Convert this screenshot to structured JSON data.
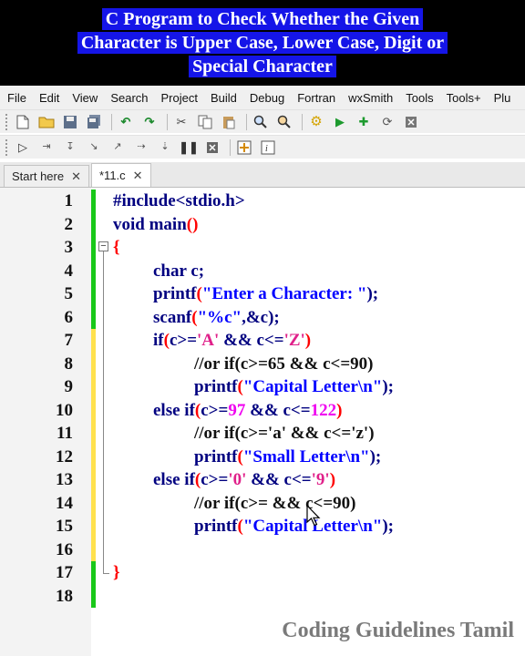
{
  "banner": {
    "lines": [
      "C Program to Check Whether the Given",
      "Character is Upper Case, Lower Case, Digit or",
      "Special Character"
    ]
  },
  "menu": [
    "File",
    "Edit",
    "View",
    "Search",
    "Project",
    "Build",
    "Debug",
    "Fortran",
    "wxSmith",
    "Tools",
    "Tools+",
    "Plu"
  ],
  "tabs": [
    {
      "label": "Start here",
      "active": false
    },
    {
      "label": "*11.c",
      "active": true
    }
  ],
  "editor": {
    "line_numbers": [
      "1",
      "2",
      "3",
      "4",
      "5",
      "6",
      "7",
      "8",
      "9",
      "10",
      "11",
      "12",
      "13",
      "14",
      "15",
      "16",
      "17",
      "18"
    ],
    "code": [
      [
        {
          "t": "#include<stdio.h>",
          "c": "kw"
        }
      ],
      [
        {
          "t": "void main",
          "c": "kw"
        },
        {
          "t": "()",
          "c": "br"
        }
      ],
      [
        {
          "t": "{",
          "c": "br"
        }
      ],
      [
        {
          "t": "char c;",
          "c": "kw"
        }
      ],
      [
        {
          "t": "printf",
          "c": "kw"
        },
        {
          "t": "(",
          "c": "br"
        },
        {
          "t": "\"Enter a Character: \"",
          "c": "st"
        },
        {
          "t": ");",
          "c": "kw"
        }
      ],
      [
        {
          "t": "scanf",
          "c": "kw"
        },
        {
          "t": "(",
          "c": "br"
        },
        {
          "t": "\"%c\"",
          "c": "st"
        },
        {
          "t": ",&c);",
          "c": "kw"
        }
      ],
      [
        {
          "t": "if",
          "c": "kw"
        },
        {
          "t": "(",
          "c": "br"
        },
        {
          "t": "c>=",
          "c": "kw"
        },
        {
          "t": "'A'",
          "c": "ch"
        },
        {
          "t": " && c<=",
          "c": "kw"
        },
        {
          "t": "'Z'",
          "c": "ch"
        },
        {
          "t": ")",
          "c": "br"
        }
      ],
      [
        {
          "t": "//or if(c>=65 && c<=90)",
          "c": "cm"
        }
      ],
      [
        {
          "t": "printf",
          "c": "kw"
        },
        {
          "t": "(",
          "c": "br"
        },
        {
          "t": "\"Capital Letter\\n\"",
          "c": "st"
        },
        {
          "t": ");",
          "c": "kw"
        }
      ],
      [
        {
          "t": "else if",
          "c": "kw"
        },
        {
          "t": "(",
          "c": "br"
        },
        {
          "t": "c>=",
          "c": "kw"
        },
        {
          "t": "97",
          "c": "nm"
        },
        {
          "t": " && c<=",
          "c": "kw"
        },
        {
          "t": "122",
          "c": "nm"
        },
        {
          "t": ")",
          "c": "br"
        }
      ],
      [
        {
          "t": "//or if(c>='a' && c<='z')",
          "c": "cm"
        }
      ],
      [
        {
          "t": "printf",
          "c": "kw"
        },
        {
          "t": "(",
          "c": "br"
        },
        {
          "t": "\"Small Letter\\n\"",
          "c": "st"
        },
        {
          "t": ");",
          "c": "kw"
        }
      ],
      [
        {
          "t": "else if",
          "c": "kw"
        },
        {
          "t": "(",
          "c": "br"
        },
        {
          "t": "c>=",
          "c": "kw"
        },
        {
          "t": "'0'",
          "c": "ch"
        },
        {
          "t": " && c<=",
          "c": "kw"
        },
        {
          "t": "'9'",
          "c": "ch"
        },
        {
          "t": ")",
          "c": "br"
        }
      ],
      [
        {
          "t": "//or if(c>= && c<=90)",
          "c": "cm"
        }
      ],
      [
        {
          "t": "printf",
          "c": "kw"
        },
        {
          "t": "(",
          "c": "br"
        },
        {
          "t": "\"Capital Letter\\n\"",
          "c": "st"
        },
        {
          "t": ");",
          "c": "kw"
        }
      ],
      [],
      [
        {
          "t": "}",
          "c": "br"
        }
      ],
      []
    ]
  },
  "watermark": "Coding Guidelines Tamil",
  "colors": {
    "banner_bg": "#000000",
    "banner_highlight": "#1515e8",
    "keyword": "#000080",
    "string": "#0000ff",
    "char_literal": "#e0208a",
    "number": "#f000f0",
    "brace": "#ff0000",
    "changebar_saved": "#19c819",
    "changebar_modified": "#ffe14d"
  }
}
